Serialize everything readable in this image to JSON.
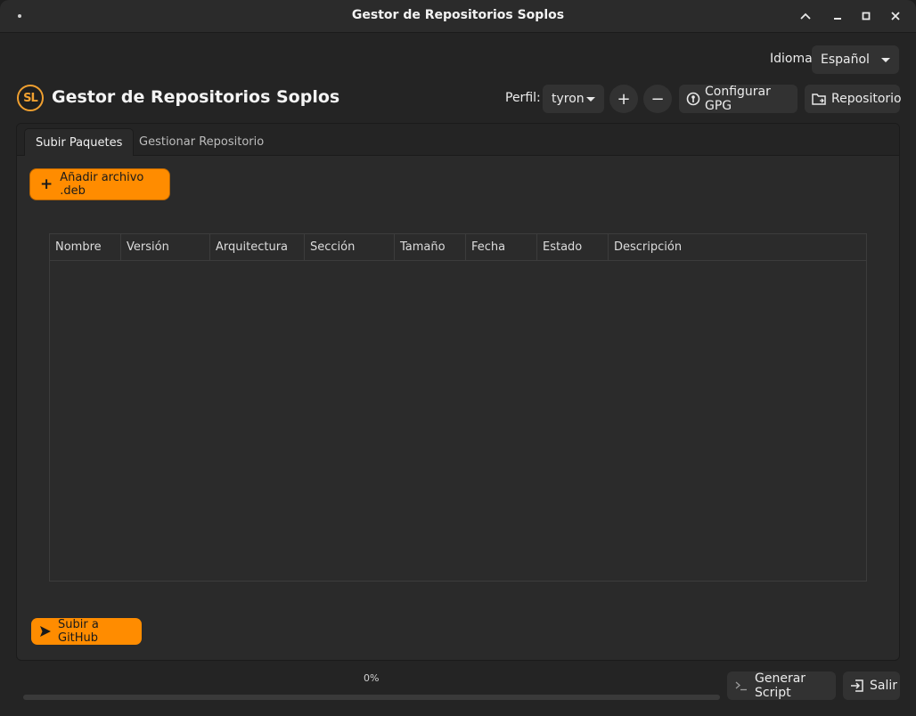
{
  "window": {
    "title": "Gestor de Repositorios Soplos"
  },
  "language": {
    "label": "Idioma",
    "selected": "Español"
  },
  "header": {
    "logo_text": "SL",
    "title": "Gestor de Repositorios Soplos",
    "profile_label": "Perfil:",
    "profile_selected": "tyron",
    "add_symbol": "+",
    "remove_symbol": "−",
    "gpg_label": "Configurar GPG",
    "repo_label": "Repositorio"
  },
  "tabs": [
    {
      "label": "Subir Paquetes",
      "active": true
    },
    {
      "label": "Gestionar Repositorio",
      "active": false
    }
  ],
  "upload": {
    "add_button": "Añadir archivo .deb",
    "columns": [
      "Nombre",
      "Versión",
      "Arquitectura",
      "Sección",
      "Tamaño",
      "Fecha",
      "Estado",
      "Descripción"
    ],
    "rows": [],
    "push_button": "Subir a GitHub"
  },
  "footer": {
    "progress_text": "0%",
    "progress_value": 0,
    "script_button": "Generar Script",
    "exit_button": "Salir"
  },
  "colors": {
    "accent": "#ff8c00",
    "background": "#242424",
    "panel": "#2a2a2a"
  }
}
